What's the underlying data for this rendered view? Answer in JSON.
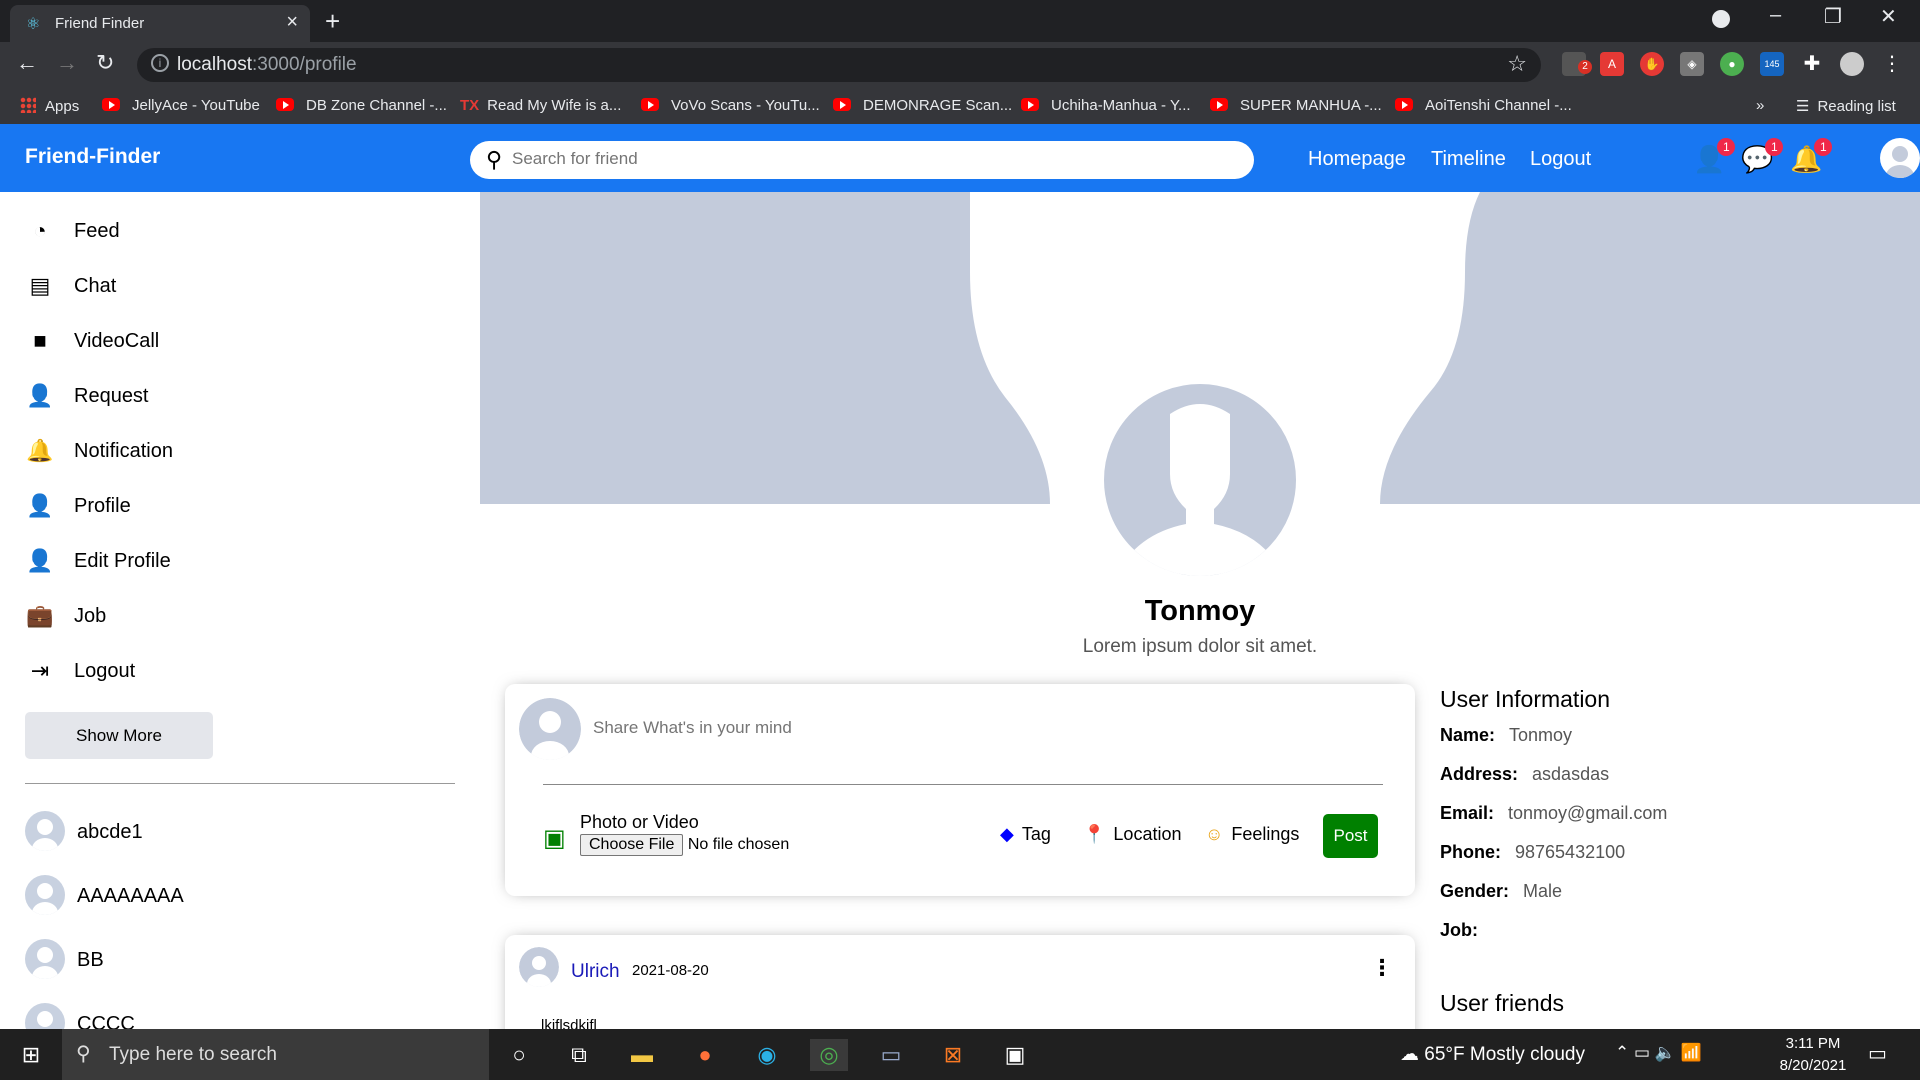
{
  "browser": {
    "tab_title": "Friend Finder",
    "url_host": "localhost",
    "url_path": ":3000/profile",
    "bookmarks": [
      "Apps",
      "JellyAce - YouTube",
      "DB Zone Channel -...",
      "Read My Wife is a...",
      "VoVo Scans - YouTu...",
      "DEMONRAGE Scan...",
      "Uchiha-Manhua - Y...",
      "SUPER MANHUA -...",
      "AoiTenshi Channel -..."
    ],
    "more": "»",
    "reading_list": "Reading list",
    "ext_badges": {
      "mail": "2",
      "counter": "145"
    }
  },
  "navbar": {
    "brand": "Friend-Finder",
    "search_placeholder": "Search for friend",
    "links": [
      "Homepage",
      "Timeline",
      "Logout"
    ],
    "badges": {
      "requests": "1",
      "messages": "1",
      "notifications": "1"
    }
  },
  "sidebar": {
    "items": [
      "Feed",
      "Chat",
      "VideoCall",
      "Request",
      "Notification",
      "Profile",
      "Edit Profile",
      "Job",
      "Logout"
    ],
    "show_more": "Show More",
    "friends": [
      "abcde1",
      "AAAAAAAA",
      "BB",
      "CCCC"
    ]
  },
  "profile": {
    "name": "Tonmoy",
    "description": "Lorem ipsum dolor sit amet."
  },
  "share": {
    "placeholder": "Share What's in your mind",
    "photo_label": "Photo or Video",
    "choose_file": "Choose File",
    "no_file": "No file chosen",
    "tag": "Tag",
    "location": "Location",
    "feelings": "Feelings",
    "post": "Post"
  },
  "post": {
    "username": "Ulrich",
    "date": "2021-08-20",
    "body": "lkjflsdkjfl"
  },
  "user_info": {
    "title": "User Information",
    "rows": [
      {
        "k": "Name:",
        "v": "Tonmoy"
      },
      {
        "k": "Address:",
        "v": "asdasdas"
      },
      {
        "k": "Email:",
        "v": "tonmoy@gmail.com"
      },
      {
        "k": "Phone:",
        "v": "98765432100"
      },
      {
        "k": "Gender:",
        "v": "Male"
      },
      {
        "k": "Job:",
        "v": ""
      }
    ],
    "friends_title": "User friends"
  },
  "taskbar": {
    "search_placeholder": "Type here to search",
    "weather": "65°F  Mostly cloudy",
    "time": "3:11 PM",
    "date": "8/20/2021"
  },
  "colors": {
    "primary": "#1877f2",
    "post_green": "#008000",
    "cover": "#c3cbdb"
  }
}
